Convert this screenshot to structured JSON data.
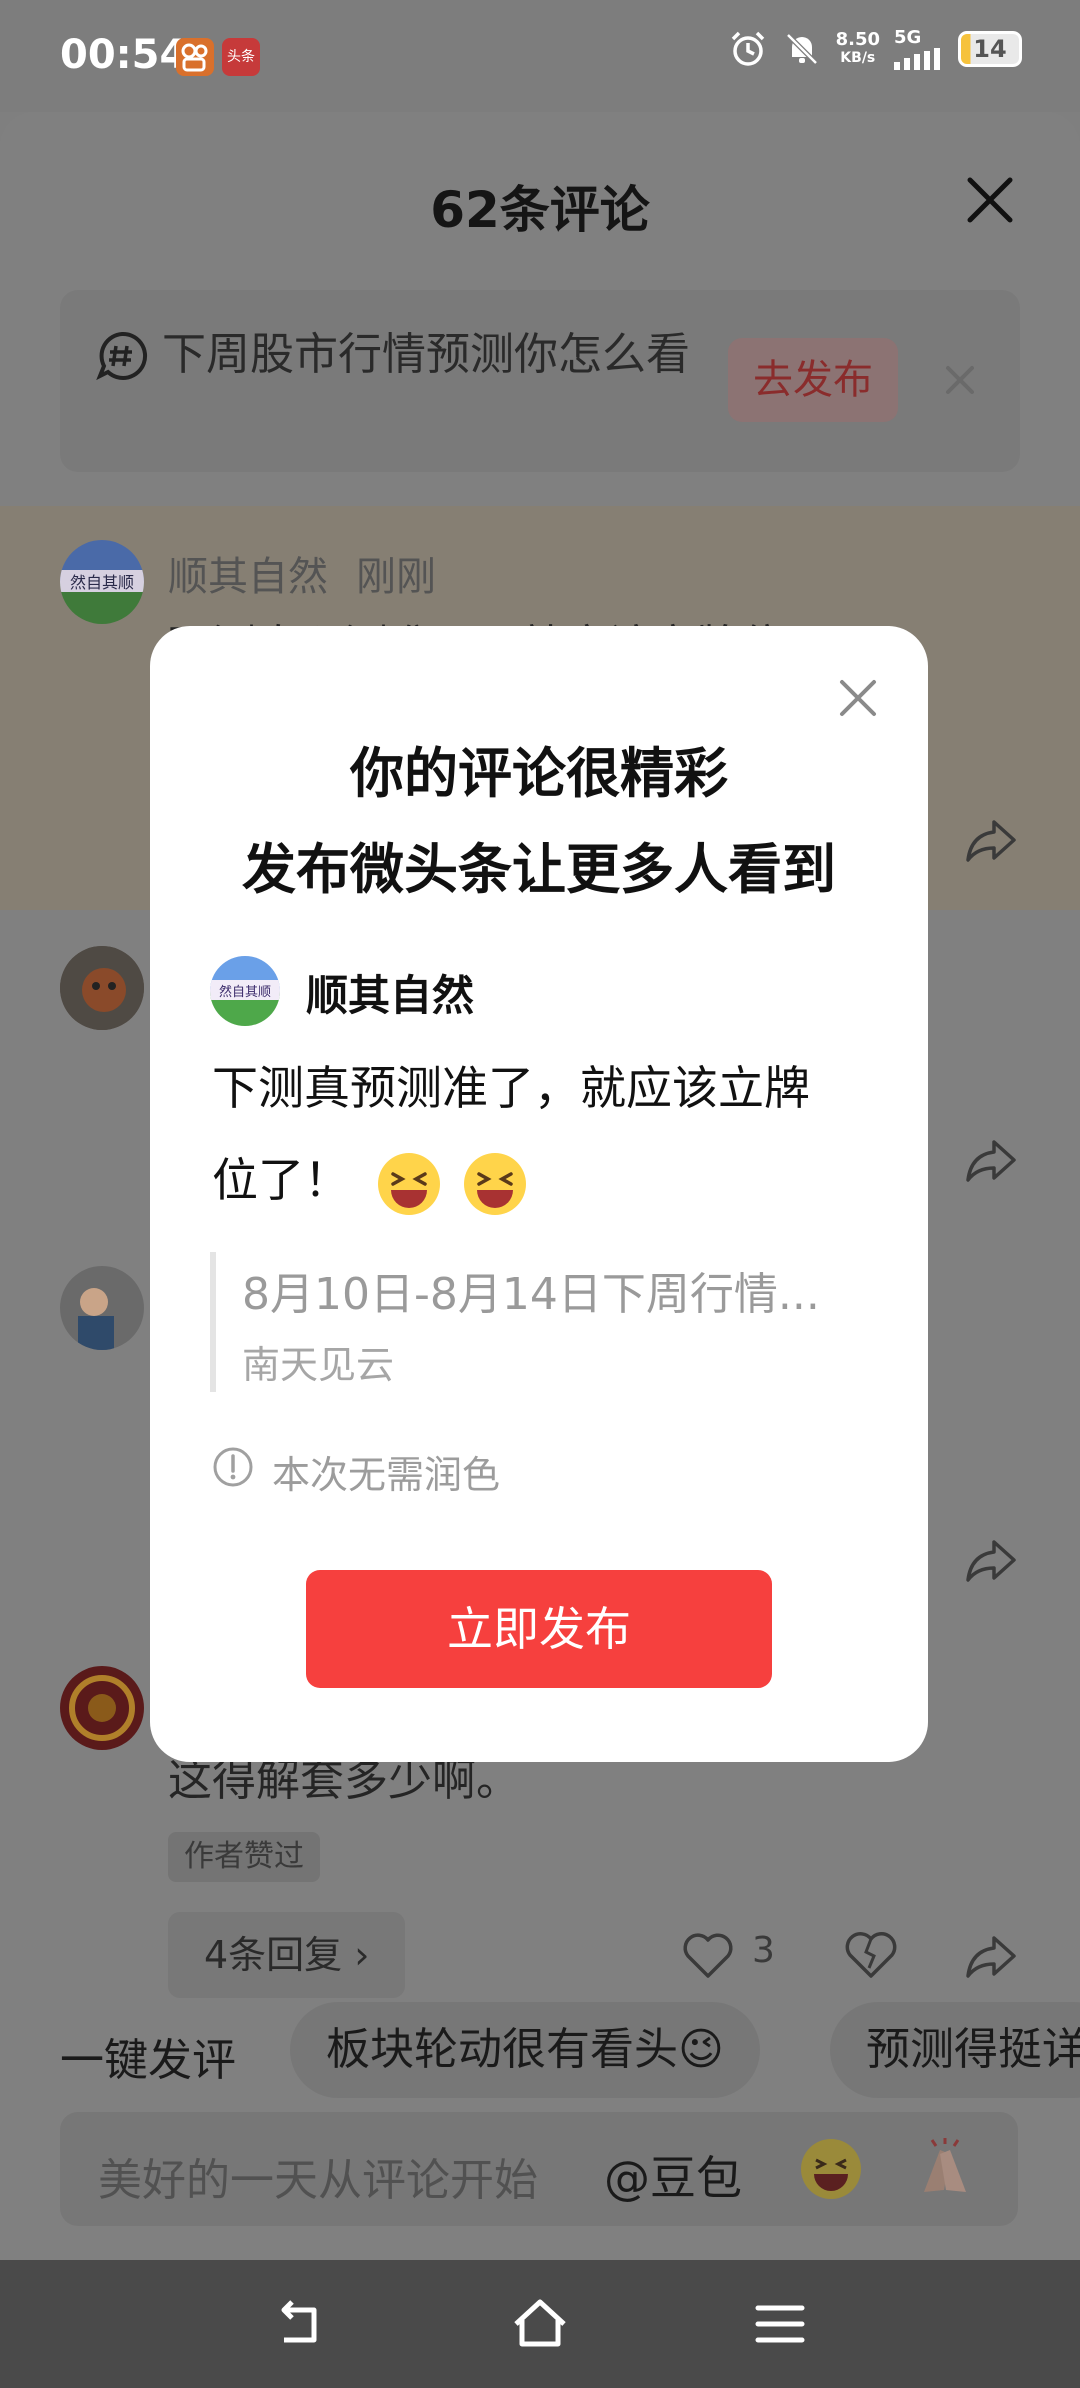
{
  "status_bar": {
    "time": "00:54",
    "app_icon_1": "kuaishou-icon",
    "app_icon_2_label": "头条",
    "net_speed": "8.50",
    "net_unit": "KB/s",
    "network": "5G",
    "battery": "14"
  },
  "sheet": {
    "title": "62条评论",
    "topic": {
      "text": "下周股市行情预测你怎么看",
      "button": "去发布"
    },
    "comments": [
      {
        "name": "顺其自然",
        "time": "刚刚",
        "text": "下测真预测准了，就应该立牌位"
      },
      {
        "name": "",
        "text": "这得解套多少啊。",
        "author_tag": "作者赞过",
        "replies": "4条回复 ›",
        "likes": "3"
      }
    ],
    "quick_reply": {
      "label": "一键发评",
      "chips": [
        "板块轮动很有看头😉",
        "预测得挺详"
      ]
    },
    "input": {
      "placeholder": "美好的一天从评论开始",
      "mention": "@豆包"
    }
  },
  "dialog": {
    "title_line1": "你的评论很精彩",
    "title_line2": "发布微头条让更多人看到",
    "user_name": "顺其自然",
    "comment": "下测真预测准了，就应该立牌位了！",
    "quote_title": "8月10日-8月14日下周行情...",
    "quote_author": "南天见云",
    "notice": "本次无需润色",
    "publish_button": "立即发布"
  },
  "colors": {
    "accent_red": "#f6403e",
    "overlay_gray": "#808080",
    "dialog_bg": "#ffffff"
  }
}
